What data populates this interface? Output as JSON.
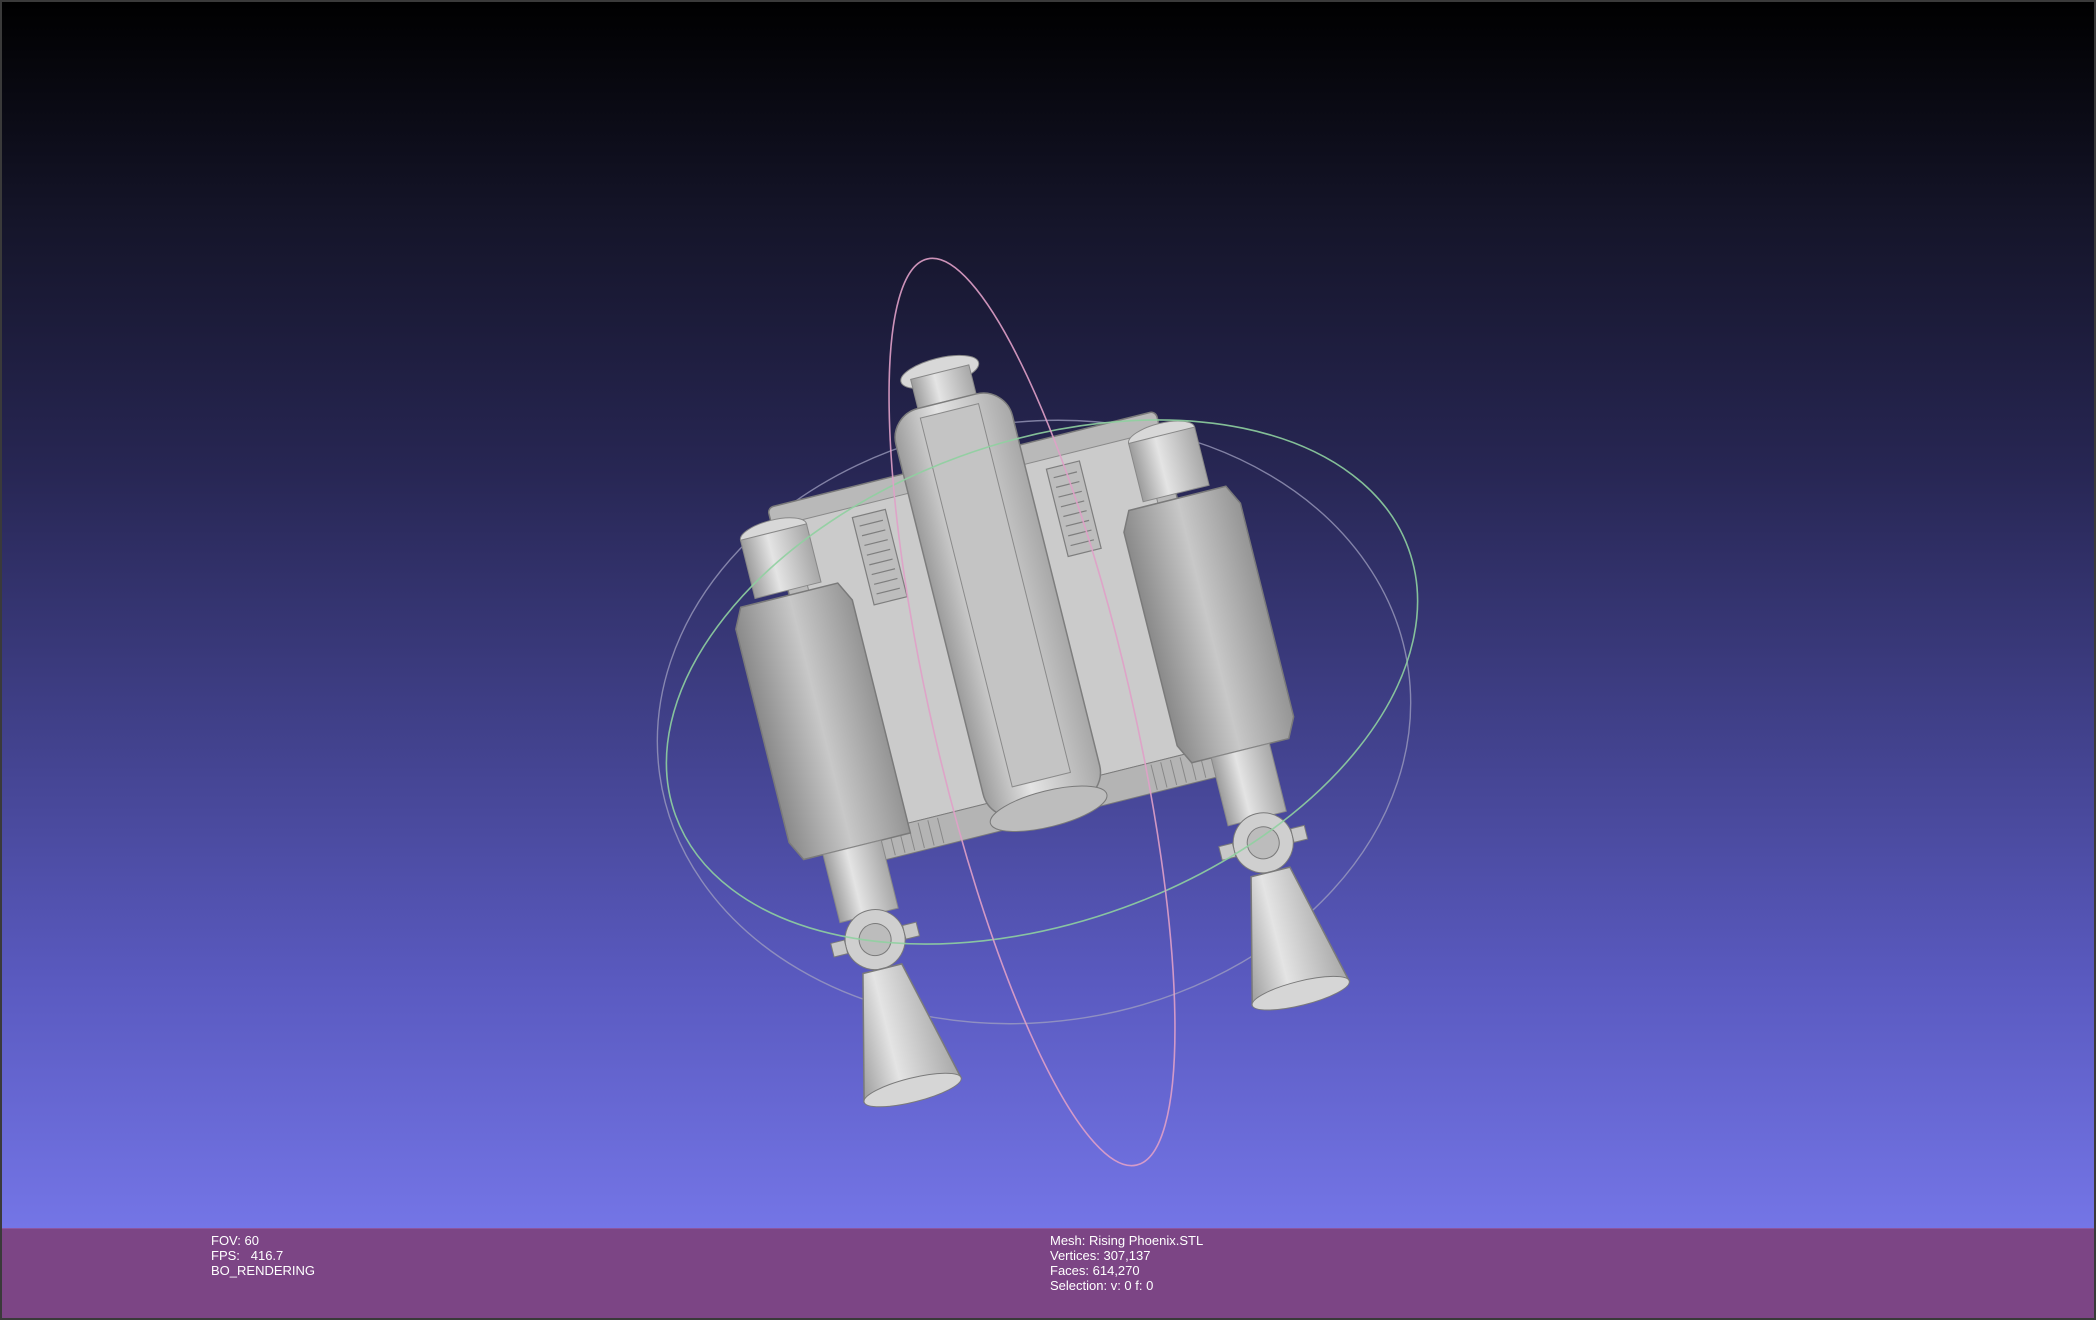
{
  "viewer": {
    "background_top": "#000000",
    "background_bottom": "#7475e6",
    "status_bar_color": "#7c4585",
    "model_color": "#d0d0d0",
    "trackball_colors": [
      "#8fd0a0",
      "#e0a0c8",
      "#a0a0c0"
    ]
  },
  "render_info": {
    "fov": "FOV: 60",
    "fps": "FPS:   416.7",
    "mode": "BO_RENDERING"
  },
  "mesh_info": {
    "mesh": "Mesh: Rising Phoenix.STL",
    "vertices": "Vertices: 307,137",
    "faces": "Faces: 614,270",
    "selection": "Selection: v: 0 f: 0"
  },
  "scene": {
    "model": "jetpack-3d-model",
    "icons": [
      "trackball-gizmo"
    ]
  }
}
